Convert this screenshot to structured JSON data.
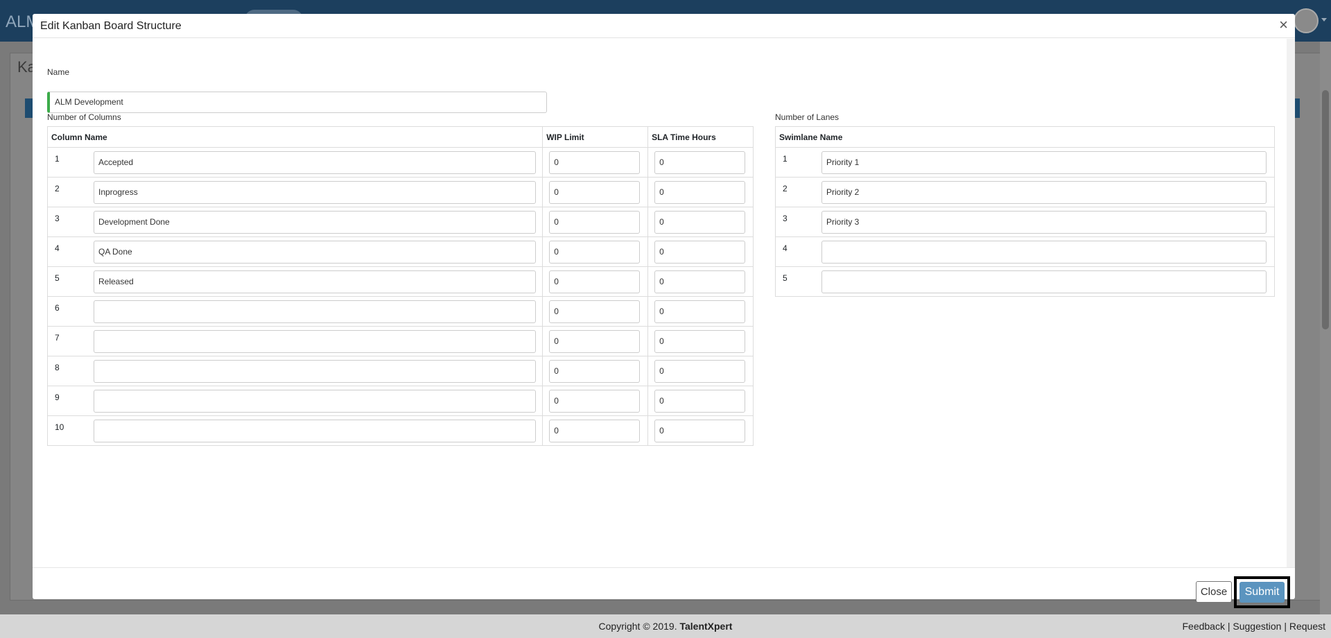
{
  "background": {
    "brand": "ALM",
    "page_title": "Ka"
  },
  "modal": {
    "title": "Edit Kanban Board Structure",
    "close_icon": "×",
    "name_label": "Name",
    "name_value": "ALM Development",
    "columns_label": "Number of Columns",
    "lanes_label": "Number of Lanes",
    "columns_table": {
      "headers": [
        "Column Name",
        "WIP Limit",
        "SLA Time Hours"
      ],
      "rows": [
        {
          "num": "1",
          "name": "Accepted",
          "wip": "0",
          "sla": "0"
        },
        {
          "num": "2",
          "name": "Inprogress",
          "wip": "0",
          "sla": "0"
        },
        {
          "num": "3",
          "name": "Development Done",
          "wip": "0",
          "sla": "0"
        },
        {
          "num": "4",
          "name": "QA Done",
          "wip": "0",
          "sla": "0"
        },
        {
          "num": "5",
          "name": "Released",
          "wip": "0",
          "sla": "0"
        },
        {
          "num": "6",
          "name": "",
          "wip": "0",
          "sla": "0"
        },
        {
          "num": "7",
          "name": "",
          "wip": "0",
          "sla": "0"
        },
        {
          "num": "8",
          "name": "",
          "wip": "0",
          "sla": "0"
        },
        {
          "num": "9",
          "name": "",
          "wip": "0",
          "sla": "0"
        },
        {
          "num": "10",
          "name": "",
          "wip": "0",
          "sla": "0"
        }
      ]
    },
    "lanes_table": {
      "header": "Swimlane Name",
      "rows": [
        {
          "num": "1",
          "name": "Priority 1"
        },
        {
          "num": "2",
          "name": "Priority 2"
        },
        {
          "num": "3",
          "name": "Priority 3"
        },
        {
          "num": "4",
          "name": ""
        },
        {
          "num": "5",
          "name": ""
        }
      ]
    },
    "close_button": "Close",
    "submit_button": "Submit"
  },
  "footer": {
    "copyright": "Copyright © 2019.",
    "company": "TalentXpert",
    "links": "Feedback | Suggestion | Request"
  },
  "colors": {
    "accent_green": "#3cab4a",
    "submit_blue": "#5b94bf",
    "topbar": "#1c3f5e"
  }
}
